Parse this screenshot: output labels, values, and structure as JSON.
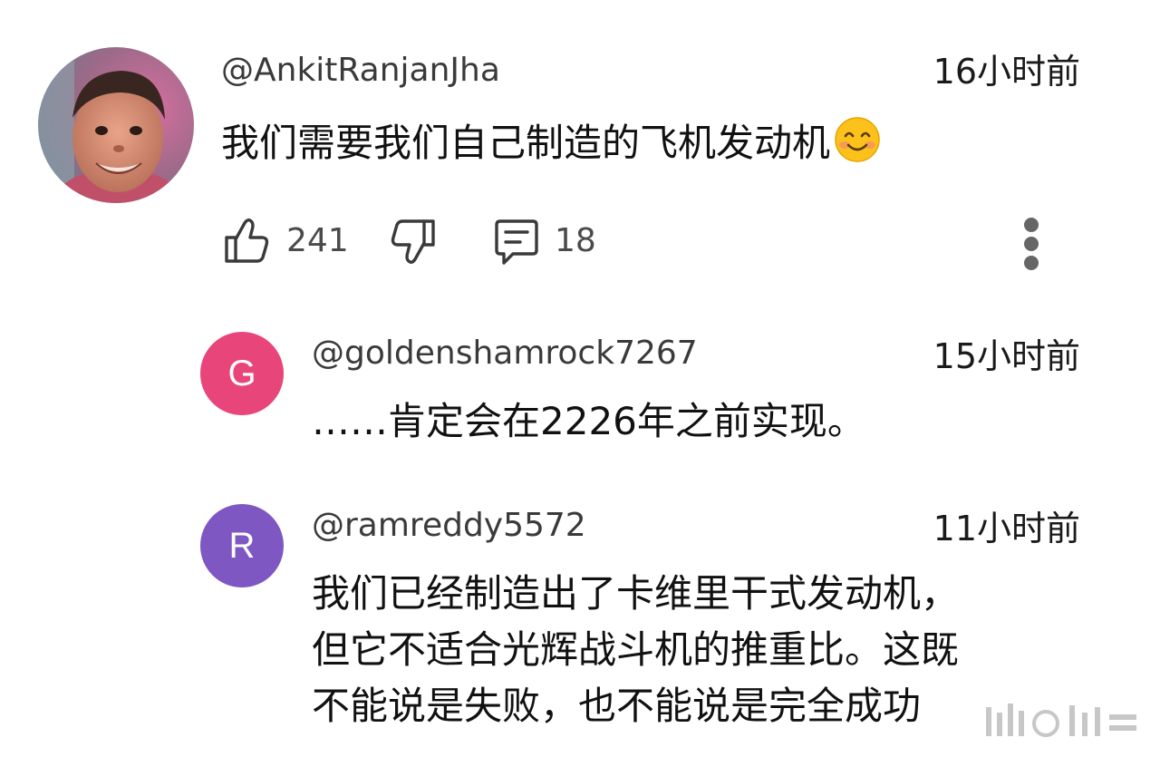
{
  "comment": {
    "author": "@AnkitRanjanJha",
    "time": "16小时前",
    "text": "我们需要我们自己制造的飞机发动机",
    "emoji": "smiling-face-emoji",
    "likes": "241",
    "replies_count": "18"
  },
  "replies": [
    {
      "avatar_letter": "G",
      "avatar_color": "#e8457a",
      "author": "@goldenshamrock7267",
      "time": "15小时前",
      "text": "……肯定会在2226年之前实现。"
    },
    {
      "avatar_letter": "R",
      "avatar_color": "#7e57c2",
      "author": "@ramreddy5572",
      "time": "11小时前",
      "lines": [
        "我们已经制造出了卡维里干式发动机，",
        "但它不适合光辉战斗机的推重比。这既",
        "不能说是失败，也不能说是完全成功"
      ]
    }
  ],
  "icons": {
    "like": "thumbs-up-icon",
    "dislike": "thumbs-down-icon",
    "reply": "comment-icon",
    "more": "more-vertical-icon"
  }
}
